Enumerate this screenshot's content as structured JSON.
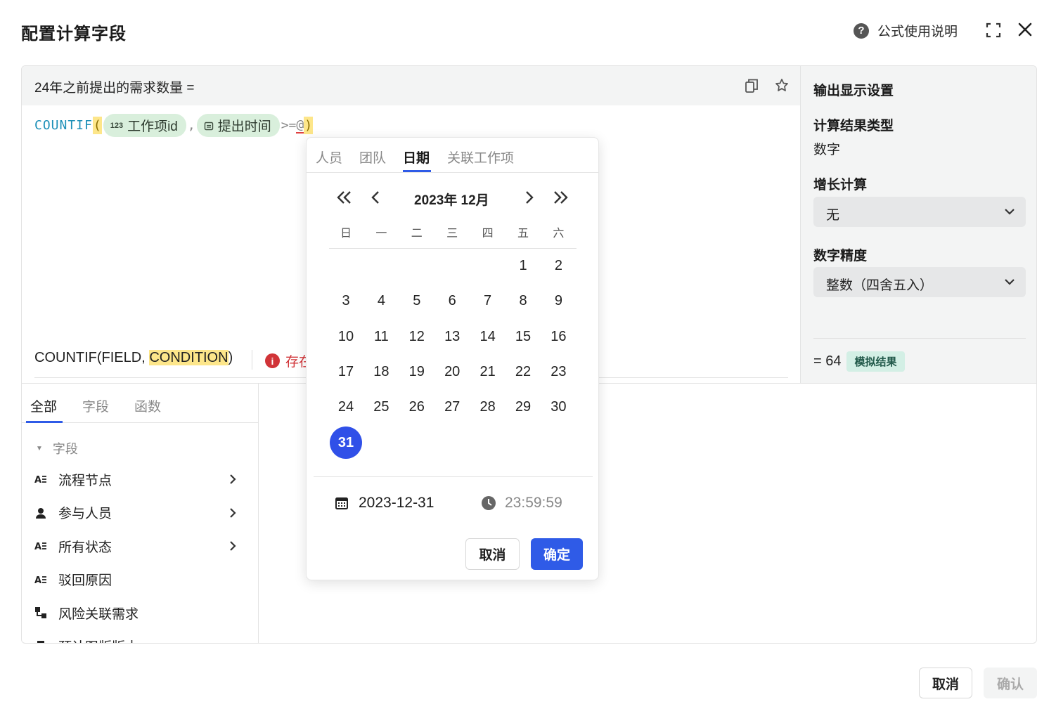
{
  "dialog": {
    "title": "配置计算字段",
    "help_label": "公式使用说明",
    "cancel_label": "取消",
    "confirm_label": "确认"
  },
  "formula": {
    "name": "24年之前提出的需求数量 =",
    "fn": "COUNTIF",
    "open_paren": "(",
    "close_paren": ")",
    "field1_icon": "123",
    "field1": "工作项id",
    "comma": ",",
    "field2": "提出时间",
    "operator": ">=",
    "at": "@",
    "hint_prefix": "COUNTIF(FIELD, ",
    "hint_highlight": "CONDITION",
    "hint_suffix": ")",
    "error_text": "存在"
  },
  "output_settings": {
    "title": "输出显示设置",
    "result_type_label": "计算结果类型",
    "result_type_value": "数字",
    "growth_label": "增长计算",
    "growth_value": "无",
    "precision_label": "数字精度",
    "precision_value": "整数（四舍五入）",
    "result_value": "= 64",
    "result_badge": "模拟结果"
  },
  "left_tabs": [
    "全部",
    "字段",
    "函数"
  ],
  "field_group": "字段",
  "fields": [
    {
      "label": "流程节点",
      "icon": "text-list-icon",
      "has_arrow": true
    },
    {
      "label": "参与人员",
      "icon": "person-icon",
      "has_arrow": true
    },
    {
      "label": "所有状态",
      "icon": "text-list-icon",
      "has_arrow": true
    },
    {
      "label": "驳回原因",
      "icon": "text-list-icon",
      "has_arrow": false
    },
    {
      "label": "风险关联需求",
      "icon": "link-icon",
      "has_arrow": false
    },
    {
      "label": "预计跟版版本",
      "icon": "bookmark-icon",
      "has_arrow": false
    }
  ],
  "picker": {
    "tabs": [
      "人员",
      "团队",
      "日期",
      "关联工作项"
    ],
    "active_tab": "日期",
    "month_label": "2023年 12月",
    "weekdays": [
      "日",
      "一",
      "二",
      "三",
      "四",
      "五",
      "六"
    ],
    "first_weekday_index": 5,
    "days_in_month": 31,
    "selected_day": 31,
    "date_value": "2023-12-31",
    "time_value": "23:59:59",
    "cancel_label": "取消",
    "ok_label": "确定"
  },
  "colors": {
    "accent": "#2f5be7",
    "chip_bg": "#d9efdc",
    "highlight": "#fde68a",
    "error": "#d13438",
    "badge_bg": "#d3efe5"
  }
}
